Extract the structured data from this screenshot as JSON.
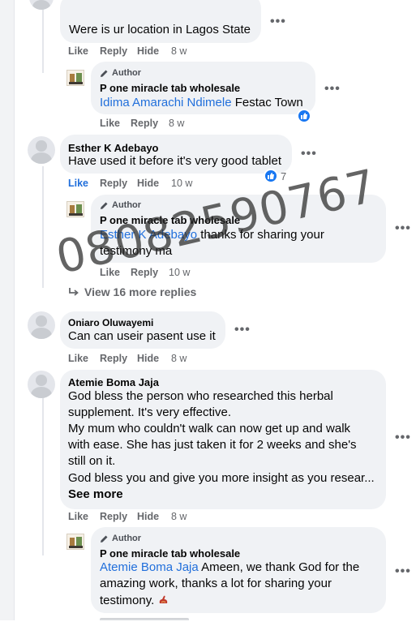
{
  "comments": [
    {
      "text": "Were is ur location in Lagos State",
      "actions": {
        "like": "Like",
        "reply": "Reply",
        "hide": "Hide",
        "time": "8 w"
      },
      "reply": {
        "author_badge": "Author",
        "name": "P one miracle tab wholesale",
        "mention": "Idima Amarachi Ndimele",
        "text": " Festac Town",
        "actions": {
          "like": "Like",
          "reply": "Reply",
          "time": "8 w"
        }
      }
    },
    {
      "name": "Esther K Adebayo",
      "text": "Have used it before it's very good tablet",
      "reaction_count": "7",
      "actions": {
        "like": "Like",
        "reply": "Reply",
        "hide": "Hide",
        "time": "10 w"
      },
      "reply": {
        "author_badge": "Author",
        "name": "P one miracle tab wholesale",
        "mention": "Esther K Adebayo",
        "line1": " thanks for sharing your",
        "line2": "testimony ma",
        "actions": {
          "like": "Like",
          "reply": "Reply",
          "time": "10 w"
        }
      },
      "view_replies": "View 16 more replies"
    },
    {
      "name": "Oniaro Oluwayemi",
      "text": "Can can useir pasent use it",
      "actions": {
        "like": "Like",
        "reply": "Reply",
        "hide": "Hide",
        "time": "8 w"
      }
    },
    {
      "name": "Atemie Boma Jaja",
      "lines": [
        "God bless the person who researched this herbal",
        "supplement. It's very effective.",
        "My mum who couldn't walk can now get up and walk",
        "with ease. She has just taken it for 2 weeks and she's",
        "still on it.",
        "God bless you and give you more insight as you resear..."
      ],
      "see_more": "See more",
      "actions": {
        "like": "Like",
        "reply": "Reply",
        "hide": "Hide",
        "time": "8 w"
      },
      "reply": {
        "author_badge": "Author",
        "name": "P one miracle tab wholesale",
        "mention": "Atemie Boma Jaja",
        "line1": " Ameen, we thank God for the",
        "line2": "amazing work, thanks a lot for sharing your",
        "line3": "testimony."
      }
    }
  ],
  "more_icon": "•••",
  "watermark": "08082590767",
  "colors": {
    "link": "#216fdb",
    "bubble": "#f0f2f5",
    "muted": "#65676b",
    "like_blue": "#1877f2"
  }
}
